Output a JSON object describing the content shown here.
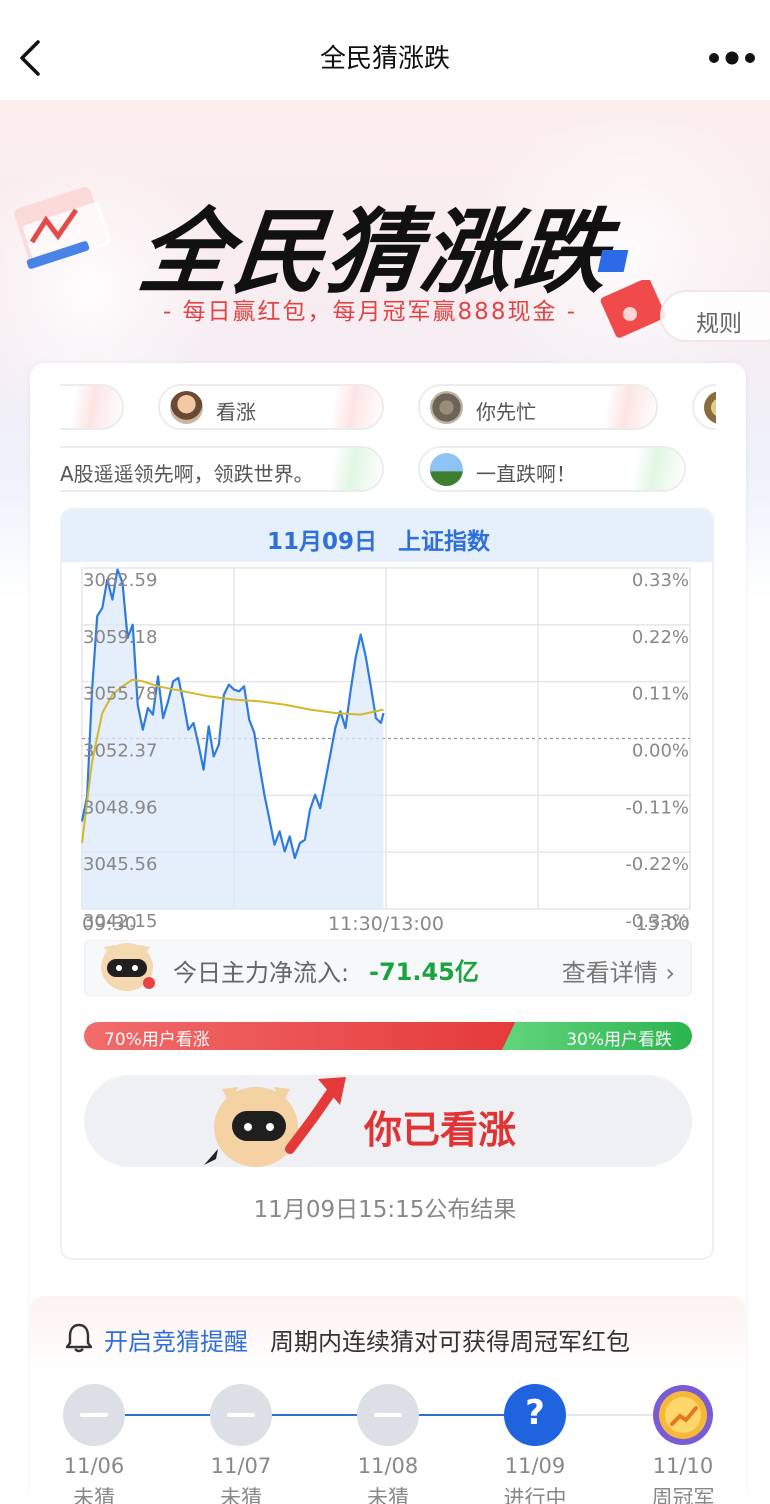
{
  "nav": {
    "title": "全民猜涨跌"
  },
  "hero": {
    "title": "全民猜涨跌",
    "subtitle": "- 每日赢红包，每月冠军赢888现金 -",
    "rules_label": "规则"
  },
  "comments": [
    {
      "text": "看涨",
      "direction": "up"
    },
    {
      "text": "你先忙",
      "direction": "up"
    },
    {
      "text": "A股遥遥领先啊，领跌世界。",
      "direction": "down"
    },
    {
      "text": "一直跌啊！",
      "direction": "down"
    }
  ],
  "chart_header": {
    "date": "11月09日",
    "index_name": "上证指数"
  },
  "chart_data": {
    "type": "line",
    "title": "11月09日 上证指数",
    "x_ticks": [
      "09:30",
      "11:30/13:00",
      "15:00"
    ],
    "y_left_ticks": [
      "3062.59",
      "3059.18",
      "3055.78",
      "3052.37",
      "3048.96",
      "3045.56",
      "3042.15"
    ],
    "y_right_ticks": [
      "0.33%",
      "0.22%",
      "0.11%",
      "0.00%",
      "-0.11%",
      "-0.22%",
      "-0.33%"
    ],
    "ylim": [
      3042.15,
      3062.59
    ],
    "baseline": 3052.37,
    "session_minutes": 240,
    "series": [
      {
        "x": [
          0,
          2,
          4,
          6,
          8,
          10,
          12,
          14,
          16,
          18,
          20,
          22,
          24,
          26,
          28,
          30,
          32,
          34,
          36,
          38,
          40,
          42,
          44,
          46,
          48,
          50,
          52,
          54,
          56,
          58,
          60,
          62,
          64,
          66,
          68,
          70,
          72,
          74,
          76,
          78,
          80,
          82,
          84,
          86,
          88,
          90,
          92,
          94,
          96,
          98,
          100,
          102,
          104,
          106,
          108,
          110,
          112,
          114,
          116,
          118,
          119
        ],
        "values": [
          3047.4,
          3048.9,
          3055.3,
          3059.7,
          3060.2,
          3061.9,
          3060.7,
          3062.5,
          3061.7,
          3058.4,
          3059.2,
          3054.4,
          3052.9,
          3054.2,
          3053.8,
          3056.1,
          3053.6,
          3054.6,
          3055.8,
          3056.0,
          3054.6,
          3052.9,
          3053.3,
          3052.0,
          3050.5,
          3053.1,
          3051.3,
          3052.0,
          3055.0,
          3055.6,
          3055.3,
          3055.2,
          3055.5,
          3053.5,
          3052.7,
          3050.8,
          3049.0,
          3047.5,
          3046.0,
          3046.8,
          3045.6,
          3046.5,
          3045.2,
          3046.1,
          3046.3,
          3048.1,
          3049.0,
          3048.2,
          3049.8,
          3051.4,
          3053.0,
          3054.0,
          3053.0,
          3055.2,
          3057.2,
          3058.6,
          3057.3,
          3055.5,
          3053.6,
          3053.3,
          3053.9
        ]
      },
      {
        "x": [
          0,
          4,
          8,
          12,
          16,
          20,
          24,
          30,
          40,
          50,
          60,
          70,
          80,
          90,
          100,
          110,
          119
        ],
        "values": [
          3046.1,
          3051.0,
          3053.9,
          3055.0,
          3055.5,
          3055.9,
          3055.8,
          3055.5,
          3055.2,
          3054.9,
          3054.7,
          3054.6,
          3054.4,
          3054.1,
          3053.9,
          3053.8,
          3054.1
        ]
      }
    ]
  },
  "flow": {
    "label": "今日主力净流入:",
    "value": "-71.45亿",
    "detail": "查看详情 ›"
  },
  "vote": {
    "up_label": "70%用户看涨",
    "down_label": "30%用户看跌",
    "up_percent": 70,
    "down_percent": 30
  },
  "result": {
    "label": "你已看涨",
    "publish_note": "11月09日15:15公布结果"
  },
  "weekly": {
    "remind_link": "开启竞猜提醒",
    "remind_desc": "周期内连续猜对可获得周冠军红包",
    "steps": [
      {
        "date": "11/06",
        "status": "未猜"
      },
      {
        "date": "11/07",
        "status": "未猜"
      },
      {
        "date": "11/08",
        "status": "未猜"
      },
      {
        "date": "11/09",
        "status": "进行中"
      },
      {
        "date": "11/10",
        "status": "周冠军"
      }
    ]
  },
  "colors": {
    "up": "#e53a3a",
    "down": "#1aa33e",
    "accent": "#2e6fd8",
    "avg_line": "#d4b82a"
  }
}
